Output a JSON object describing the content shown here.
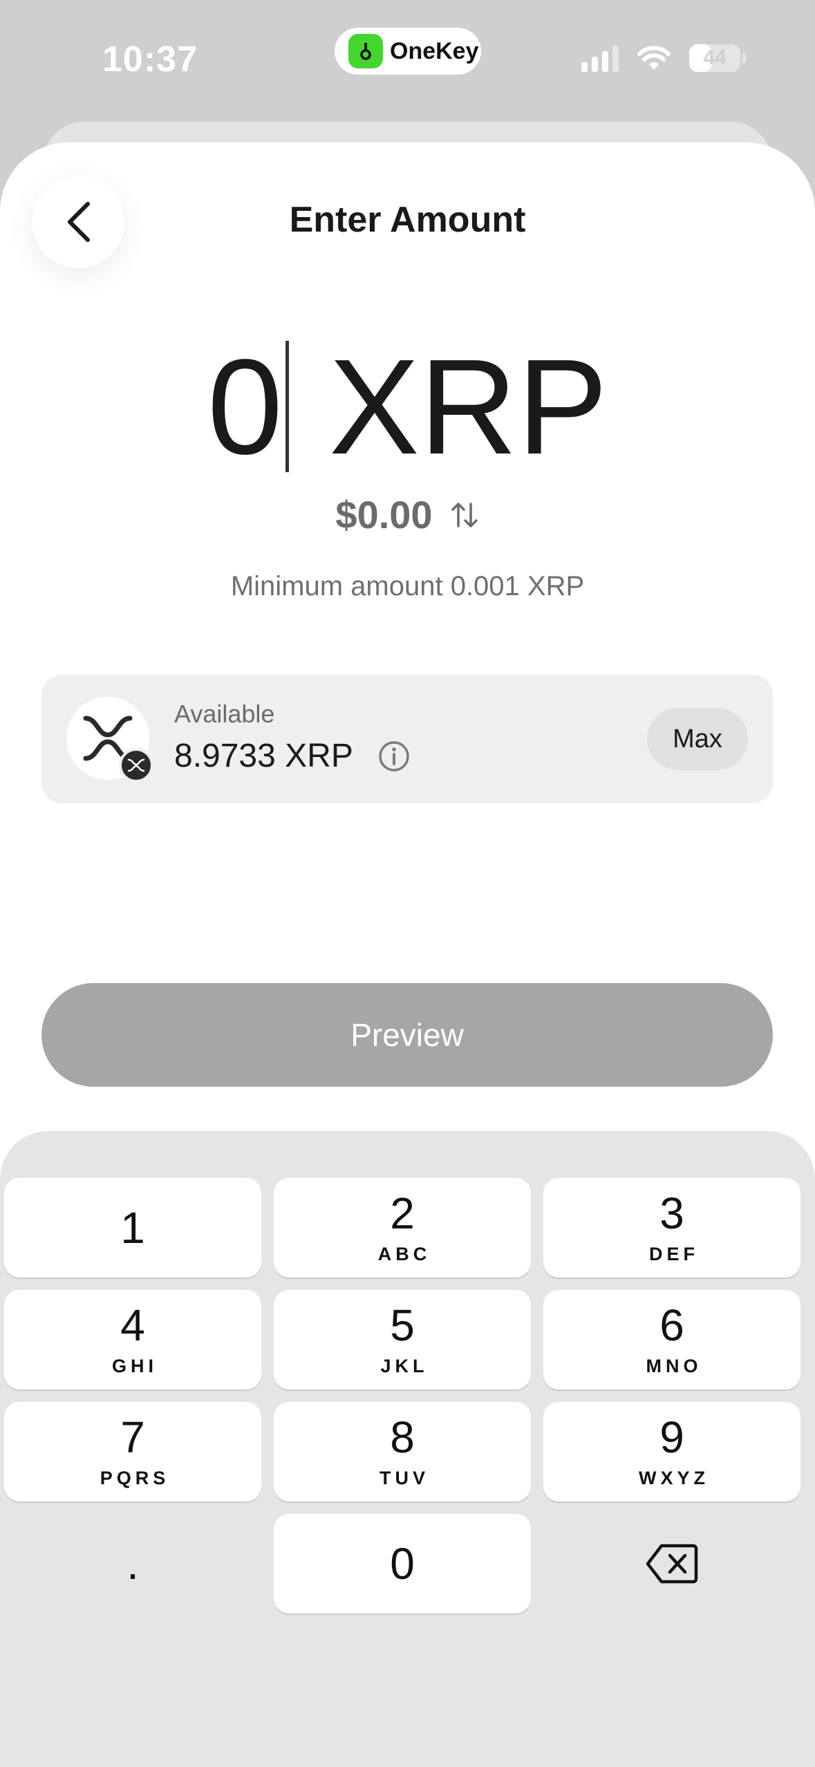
{
  "status_bar": {
    "time": "10:37",
    "island_label": "OneKey",
    "battery": "44",
    "battery_level_percent": 44
  },
  "header": {
    "title": "Enter Amount"
  },
  "amount": {
    "value": "0",
    "unit": "XRP",
    "fiat": "$0.00",
    "minimum_text": "Minimum amount 0.001 XRP"
  },
  "available": {
    "label": "Available",
    "value": "8.9733 XRP",
    "max_label": "Max"
  },
  "preview_label": "Preview",
  "keypad": {
    "keys": [
      {
        "digit": "1",
        "letters": ""
      },
      {
        "digit": "2",
        "letters": "ABC"
      },
      {
        "digit": "3",
        "letters": "DEF"
      },
      {
        "digit": "4",
        "letters": "GHI"
      },
      {
        "digit": "5",
        "letters": "JKL"
      },
      {
        "digit": "6",
        "letters": "MNO"
      },
      {
        "digit": "7",
        "letters": "PQRS"
      },
      {
        "digit": "8",
        "letters": "TUV"
      },
      {
        "digit": "9",
        "letters": "WXYZ"
      },
      {
        "digit": "0",
        "letters": ""
      }
    ],
    "decimal": "."
  },
  "colors": {
    "accent_brand": "#44d62c",
    "disabled_button": "#a6a6a6",
    "keypad_bg": "#e4e5e7"
  }
}
